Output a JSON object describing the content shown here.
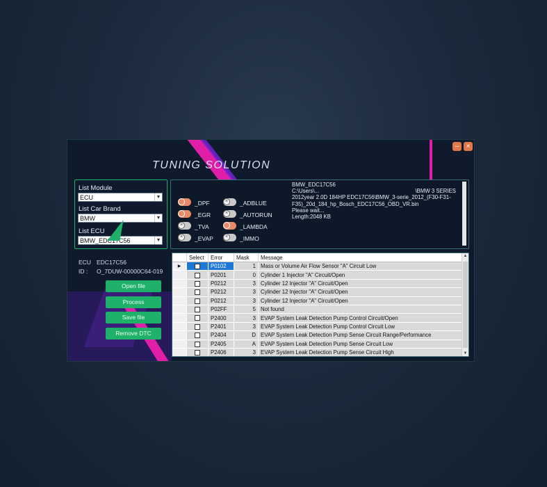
{
  "app": {
    "title": "TUNING  SOLUTION",
    "min_label": "–",
    "close_label": "×"
  },
  "left": {
    "module_label": "List Module",
    "module_value": "ECU",
    "brand_label": "List Car Brand",
    "brand_value": "BMW",
    "ecu_label": "List ECU",
    "ecu_value": "BMW_EDC17C56",
    "ecu_key": "ECU",
    "ecu_info": "EDC17C56",
    "id_key": "ID :",
    "id_info": "O_7DUW-00000C64-019"
  },
  "actions": {
    "open": "Open file",
    "process": "Process",
    "save": "Save file",
    "remove": "Remove DTC"
  },
  "toggles": [
    {
      "label": "_DPF",
      "state": "on"
    },
    {
      "label": "_EGR",
      "state": "on"
    },
    {
      "label": "_TVA",
      "state": "off"
    },
    {
      "label": "_EVAP",
      "state": "off"
    },
    {
      "label": "_ADBLUE",
      "state": "off"
    },
    {
      "label": "_AUTORUN",
      "state": "off"
    },
    {
      "label": "_LAMBDA",
      "state": "on"
    },
    {
      "label": "_IMMO",
      "state": "off"
    }
  ],
  "log": {
    "l1": "BMW_EDC17C56",
    "l2a": "C:\\Users\\...",
    "l2b": "\\BMW 3 SERIES",
    "l3": "2012year 2.0D 184HP EDC17C56\\BMW_3-serie_2012_(F30-F31-",
    "l4": "F35)_20d_184_hp_Bosch_EDC17C56_OBD_VR.bin",
    "l5": "Please wait...",
    "l6": "Length:2048 KB"
  },
  "table": {
    "headers": {
      "select": "Select",
      "error": "Error",
      "mask": "Mask",
      "message": "Message"
    },
    "rows": [
      {
        "error": "P0102",
        "mask": "1",
        "message": "Mass or Volume Air Flow Sensor \"A\" Circuit Low"
      },
      {
        "error": "P0201",
        "mask": "0",
        "message": "Cylinder 1 Injector \"A\" Circuit/Open"
      },
      {
        "error": "P0212",
        "mask": "3",
        "message": "Cylinder 12 Injector \"A\" Circuit/Open"
      },
      {
        "error": "P0212",
        "mask": "3",
        "message": "Cylinder 12 Injector \"A\" Circuit/Open"
      },
      {
        "error": "P0212",
        "mask": "3",
        "message": "Cylinder 12 Injector \"A\" Circuit/Open"
      },
      {
        "error": "P02FF",
        "mask": "5",
        "message": "Not found"
      },
      {
        "error": "P2400",
        "mask": "3",
        "message": "EVAP System Leak Detection Pump Control Circuit/Open"
      },
      {
        "error": "P2401",
        "mask": "3",
        "message": "EVAP System Leak Detection Pump Control Circuit Low"
      },
      {
        "error": "P2404",
        "mask": "D",
        "message": "EVAP System Leak Detection Pump Sense Circuit Range/Performance"
      },
      {
        "error": "P2405",
        "mask": "A",
        "message": "EVAP System Leak Detection Pump Sense Circuit Low"
      },
      {
        "error": "P2406",
        "mask": "3",
        "message": "EVAP System Leak Detection Pump Sense Circuit High"
      }
    ]
  },
  "colors": {
    "accent_green": "#1fb06a",
    "accent_pink": "#e01ea8",
    "toggle_on": "#e88a68",
    "selection_blue": "#1e78d6"
  }
}
